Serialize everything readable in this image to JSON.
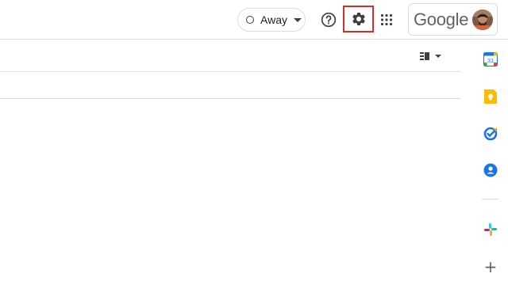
{
  "header": {
    "status": {
      "label": "Away",
      "icon": "status-ring-icon"
    },
    "help_icon": "help-icon",
    "settings_icon": "gear-icon",
    "apps_icon": "apps-grid-icon",
    "account": {
      "wordmark": "Google",
      "avatar": "user-avatar"
    }
  },
  "toolbar": {
    "view_toggle_icon": "split-pane-icon"
  },
  "side_panel": {
    "items": [
      {
        "name": "calendar",
        "icon": "calendar-icon",
        "label": "31",
        "color": "#1a73e8"
      },
      {
        "name": "keep",
        "icon": "keep-icon",
        "color": "#fbbc04"
      },
      {
        "name": "tasks",
        "icon": "tasks-icon",
        "color": "#1a73e8"
      },
      {
        "name": "contacts",
        "icon": "contacts-icon",
        "color": "#1a73e8"
      },
      {
        "name": "slack",
        "icon": "slack-icon"
      },
      {
        "name": "add",
        "icon": "plus-icon",
        "label": "+"
      }
    ]
  },
  "colors": {
    "highlight": "#d32f2f",
    "divider": "#e0e0e0"
  }
}
